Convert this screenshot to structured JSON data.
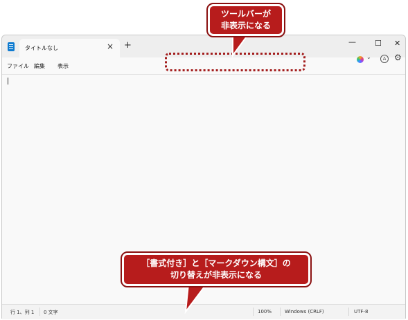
{
  "tab": {
    "title": "タイトルなし",
    "close": "×",
    "new_tab": "+"
  },
  "window_controls": {
    "minimize": "—",
    "maximize": "☐",
    "close": "✕"
  },
  "menu": {
    "items": [
      "ファイル",
      "編集",
      "表示"
    ]
  },
  "toolbar_right": {
    "chevron": "⌄",
    "account": "A",
    "settings": "⚙"
  },
  "status": {
    "position": "行 1、列 1",
    "chars": "0 文字",
    "zoom": "100%",
    "line_ending": "Windows (CRLF)",
    "encoding": "UTF-8"
  },
  "annotations": {
    "top": [
      "ツールバーが",
      "非表示になる"
    ],
    "bottom": [
      "［書式付き］と［マークダウン構文］の",
      "切り替えが非表示になる"
    ]
  },
  "colors": {
    "annotation": "#b71c1c"
  }
}
